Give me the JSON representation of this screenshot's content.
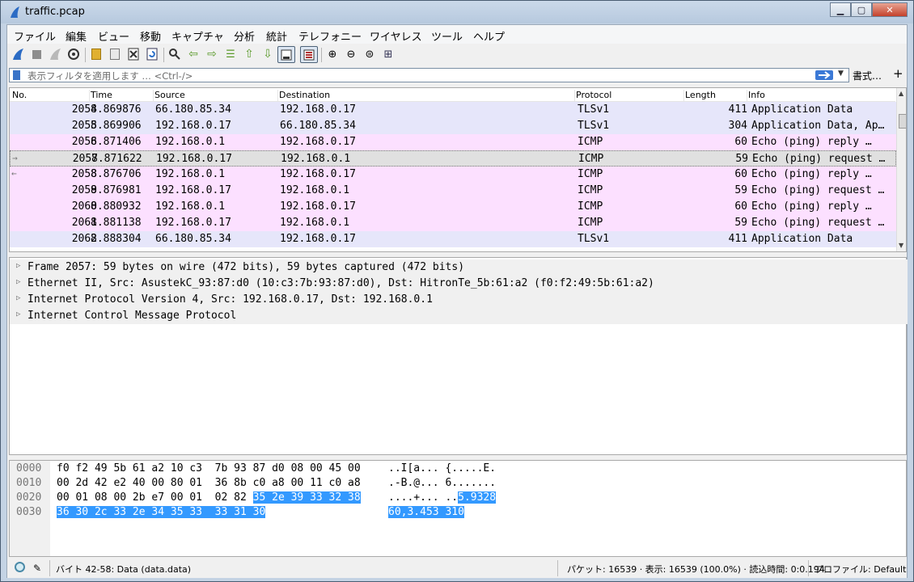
{
  "window": {
    "title": "traffic.pcap"
  },
  "menu": [
    "ファイル",
    "編集",
    "ビュー",
    "移動",
    "キャプチャ",
    "分析",
    "統計",
    "テレフォニー",
    "ワイヤレス",
    "ツール",
    "ヘルプ"
  ],
  "filter": {
    "placeholder": "表示フィルタを適用します … <Ctrl-/>",
    "expressions_label": "書式…",
    "add_label": "+"
  },
  "packet_list": {
    "columns": [
      "No.",
      "Time",
      "Source",
      "Destination",
      "Protocol",
      "Length",
      "Info"
    ],
    "rows": [
      {
        "no": "2054",
        "time": "8.869876",
        "src": "66.180.85.34",
        "dst": "192.168.0.17",
        "proto": "TLSv1",
        "len": "411",
        "info": "Application Data",
        "kind": "tls",
        "mark": ""
      },
      {
        "no": "2055",
        "time": "8.869906",
        "src": "192.168.0.17",
        "dst": "66.180.85.34",
        "proto": "TLSv1",
        "len": "304",
        "info": "Application Data, Ap…",
        "kind": "tls",
        "mark": ""
      },
      {
        "no": "2056",
        "time": "8.871406",
        "src": "192.168.0.1",
        "dst": "192.168.0.17",
        "proto": "ICMP",
        "len": "60",
        "info": "Echo (ping) reply   …",
        "kind": "icmp",
        "mark": ""
      },
      {
        "no": "2057",
        "time": "8.871622",
        "src": "192.168.0.17",
        "dst": "192.168.0.1",
        "proto": "ICMP",
        "len": "59",
        "info": "Echo (ping) request …",
        "kind": "sel",
        "mark": "→"
      },
      {
        "no": "2058",
        "time": "8.876706",
        "src": "192.168.0.1",
        "dst": "192.168.0.17",
        "proto": "ICMP",
        "len": "60",
        "info": "Echo (ping) reply   …",
        "kind": "icmp",
        "mark": "←"
      },
      {
        "no": "2059",
        "time": "8.876981",
        "src": "192.168.0.17",
        "dst": "192.168.0.1",
        "proto": "ICMP",
        "len": "59",
        "info": "Echo (ping) request …",
        "kind": "icmp",
        "mark": ""
      },
      {
        "no": "2060",
        "time": "8.880932",
        "src": "192.168.0.1",
        "dst": "192.168.0.17",
        "proto": "ICMP",
        "len": "60",
        "info": "Echo (ping) reply   …",
        "kind": "icmp",
        "mark": ""
      },
      {
        "no": "2061",
        "time": "8.881138",
        "src": "192.168.0.17",
        "dst": "192.168.0.1",
        "proto": "ICMP",
        "len": "59",
        "info": "Echo (ping) request …",
        "kind": "icmp",
        "mark": ""
      },
      {
        "no": "2062",
        "time": "8.888304",
        "src": "66.180.85.34",
        "dst": "192.168.0.17",
        "proto": "TLSv1",
        "len": "411",
        "info": "Application Data",
        "kind": "tls",
        "mark": ""
      }
    ]
  },
  "details": [
    "Frame 2057: 59 bytes on wire (472 bits), 59 bytes captured (472 bits)",
    "Ethernet II, Src: AsustekC_93:87:d0 (10:c3:7b:93:87:d0), Dst: HitronTe_5b:61:a2 (f0:f2:49:5b:61:a2)",
    "Internet Protocol Version 4, Src: 192.168.0.17, Dst: 192.168.0.1",
    "Internet Control Message Protocol"
  ],
  "hex": {
    "offsets": [
      "0000",
      "0010",
      "0020",
      "0030"
    ],
    "row0_bytes": "f0 f2 49 5b 61 a2 10 c3  7b 93 87 d0 08 00 45 00",
    "row0_ascii": "..I[a... {.....E.",
    "row1_bytes": "00 2d 42 e2 40 00 80 01  36 8b c0 a8 00 11 c0 a8",
    "row1_ascii": ".-B.@... 6.......",
    "row2_bytes_plain": "00 01 08 00 2b e7 00 01  02 82 ",
    "row2_bytes_hl": "35 2e 39 33 32 38",
    "row2_ascii_plain": "....+... ..",
    "row2_ascii_hl": "5.9328",
    "row3_bytes_hl": "36 30 2c 33 2e 34 35 33  33 31 30",
    "row3_ascii_hl": "60,3.453 310"
  },
  "status": {
    "field": "バイト 42-58: Data (data.data)",
    "packets": "パケット: 16539 · 表示: 16539 (100.0%) · 読込時間: 0:0.194",
    "profile": "プロファイル: Default"
  },
  "colors": {
    "tls": "#e6e6fa",
    "icmp": "#fce0ff",
    "highlight": "#3399ff"
  }
}
